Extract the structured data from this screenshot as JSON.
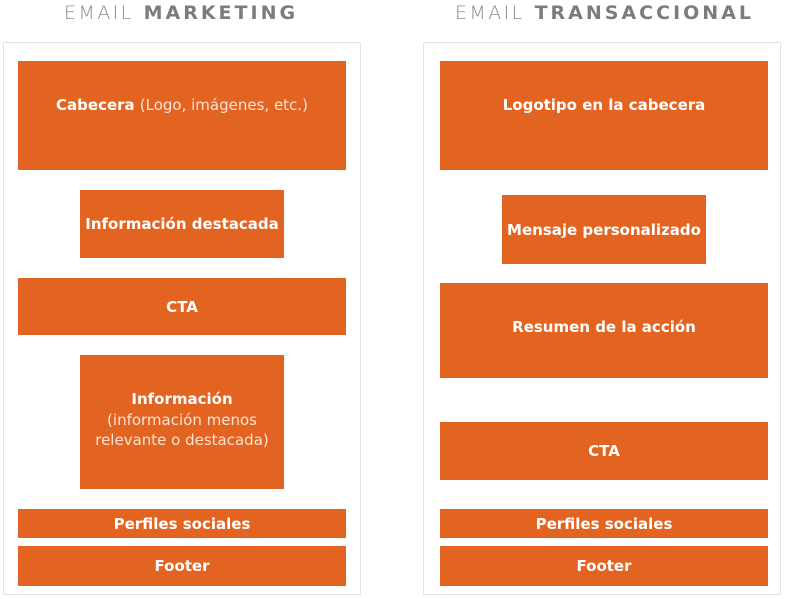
{
  "colors": {
    "accent": "#e36421",
    "title_gray": "#7c7c7c",
    "panel_border": "#e3e3e3"
  },
  "columns": [
    {
      "title_light": "EMAIL",
      "title_bold": "MARKETING",
      "blocks": [
        {
          "label": "Cabecera",
          "detail": "(Logo, imágenes, etc.)"
        },
        {
          "label": "Información destacada"
        },
        {
          "label": "CTA"
        },
        {
          "label": "Información",
          "detail_line1": "(información menos",
          "detail_line2": "relevante o destacada)"
        },
        {
          "label": "Perfiles sociales"
        },
        {
          "label": "Footer"
        }
      ]
    },
    {
      "title_light": "EMAIL",
      "title_bold": "TRANSACCIONAL",
      "blocks": [
        {
          "label": "Logotipo en la cabecera"
        },
        {
          "label": "Mensaje personalizado"
        },
        {
          "label": "Resumen de la acción"
        },
        {
          "label": "CTA"
        },
        {
          "label": "Perfiles sociales"
        },
        {
          "label": "Footer"
        }
      ]
    }
  ]
}
